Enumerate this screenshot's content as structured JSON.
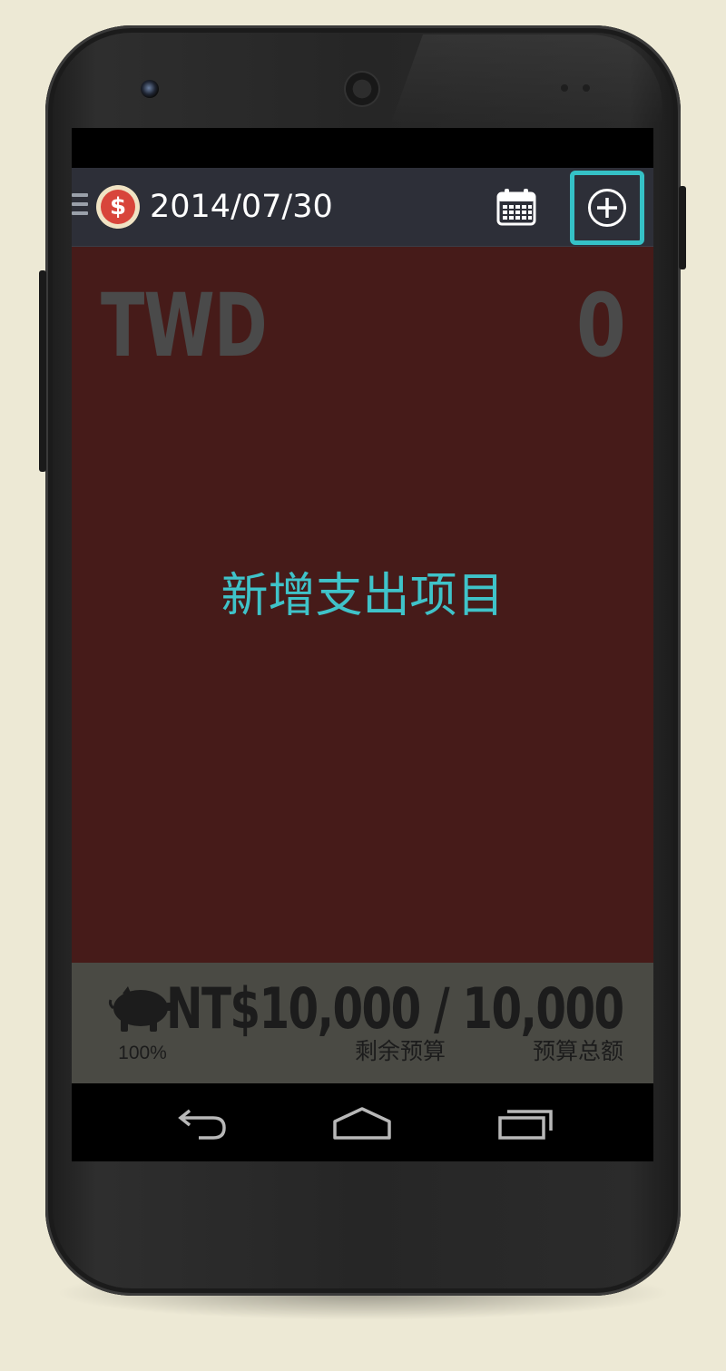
{
  "appbar": {
    "date": "2014/07/30",
    "logo_symbol": "$",
    "icons": [
      "menu-icon",
      "dollar-logo-icon",
      "calendar-icon",
      "add-circle-icon"
    ]
  },
  "main": {
    "currency": "TWD",
    "amount": "0",
    "add_prompt": "新增支出项目"
  },
  "footer": {
    "percent": "100%",
    "budget_line": "NT$10,000 / 10,000",
    "remaining_label": "剩余预算",
    "total_label": "预算总额",
    "icon": "piggy-bank-icon"
  },
  "navbar": {
    "icons": [
      "back-icon",
      "home-icon",
      "recents-icon"
    ]
  },
  "colors": {
    "accent": "#35c1c6",
    "main_bg": "#461b19",
    "appbar_bg": "#2d2f38",
    "footer_bg": "#4a4a44",
    "logo_red": "#d8453b"
  }
}
